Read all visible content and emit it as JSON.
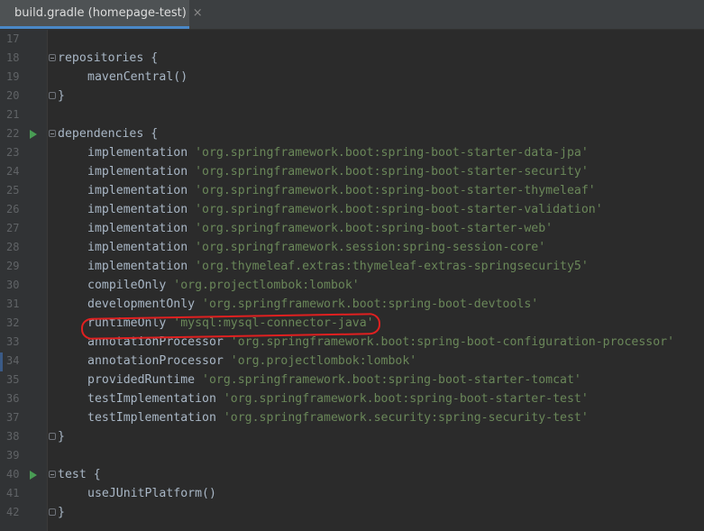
{
  "tab": {
    "title": "build.gradle (homepage-test)",
    "close_glyph": "×",
    "icon": "gradle-elephant-icon"
  },
  "colors": {
    "background": "#2b2b2b",
    "gutter": "#313335",
    "line_number": "#606366",
    "identifier": "#a9b7c6",
    "string": "#6a8759",
    "run_marker": "#499c54",
    "annotation_oval": "#e02020"
  },
  "lines": [
    {
      "n": "17",
      "indent": false,
      "text": "",
      "str": "",
      "fold": "none",
      "run": false
    },
    {
      "n": "18",
      "indent": false,
      "text": "repositories {",
      "str": "",
      "fold": "start",
      "run": false
    },
    {
      "n": "19",
      "indent": true,
      "text": "mavenCentral()",
      "str": "",
      "fold": "none",
      "run": false
    },
    {
      "n": "20",
      "indent": false,
      "text": "}",
      "str": "",
      "fold": "end",
      "run": false
    },
    {
      "n": "21",
      "indent": false,
      "text": "",
      "str": "",
      "fold": "none",
      "run": false
    },
    {
      "n": "22",
      "indent": false,
      "text": "dependencies {",
      "str": "",
      "fold": "start",
      "run": true
    },
    {
      "n": "23",
      "indent": true,
      "text": "implementation ",
      "str": "'org.springframework.boot:spring-boot-starter-data-jpa'",
      "fold": "none",
      "run": false
    },
    {
      "n": "24",
      "indent": true,
      "text": "implementation ",
      "str": "'org.springframework.boot:spring-boot-starter-security'",
      "fold": "none",
      "run": false
    },
    {
      "n": "25",
      "indent": true,
      "text": "implementation ",
      "str": "'org.springframework.boot:spring-boot-starter-thymeleaf'",
      "fold": "none",
      "run": false
    },
    {
      "n": "26",
      "indent": true,
      "text": "implementation ",
      "str": "'org.springframework.boot:spring-boot-starter-validation'",
      "fold": "none",
      "run": false
    },
    {
      "n": "27",
      "indent": true,
      "text": "implementation ",
      "str": "'org.springframework.boot:spring-boot-starter-web'",
      "fold": "none",
      "run": false
    },
    {
      "n": "28",
      "indent": true,
      "text": "implementation ",
      "str": "'org.springframework.session:spring-session-core'",
      "fold": "none",
      "run": false
    },
    {
      "n": "29",
      "indent": true,
      "text": "implementation ",
      "str": "'org.thymeleaf.extras:thymeleaf-extras-springsecurity5'",
      "fold": "none",
      "run": false
    },
    {
      "n": "30",
      "indent": true,
      "text": "compileOnly ",
      "str": "'org.projectlombok:lombok'",
      "fold": "none",
      "run": false
    },
    {
      "n": "31",
      "indent": true,
      "text": "developmentOnly ",
      "str": "'org.springframework.boot:spring-boot-devtools'",
      "fold": "none",
      "run": false
    },
    {
      "n": "32",
      "indent": true,
      "text": "runtimeOnly ",
      "str": "'mysql:mysql-connector-java'",
      "fold": "none",
      "run": false
    },
    {
      "n": "33",
      "indent": true,
      "text": "annotationProcessor ",
      "str": "'org.springframework.boot:spring-boot-configuration-processor'",
      "fold": "none",
      "run": false
    },
    {
      "n": "34",
      "indent": true,
      "text": "annotationProcessor ",
      "str": "'org.projectlombok:lombok'",
      "fold": "none",
      "run": false
    },
    {
      "n": "35",
      "indent": true,
      "text": "providedRuntime ",
      "str": "'org.springframework.boot:spring-boot-starter-tomcat'",
      "fold": "none",
      "run": false
    },
    {
      "n": "36",
      "indent": true,
      "text": "testImplementation ",
      "str": "'org.springframework.boot:spring-boot-starter-test'",
      "fold": "none",
      "run": false
    },
    {
      "n": "37",
      "indent": true,
      "text": "testImplementation ",
      "str": "'org.springframework.security:spring-security-test'",
      "fold": "none",
      "run": false
    },
    {
      "n": "38",
      "indent": false,
      "text": "}",
      "str": "",
      "fold": "end",
      "run": false
    },
    {
      "n": "39",
      "indent": false,
      "text": "",
      "str": "",
      "fold": "none",
      "run": false
    },
    {
      "n": "40",
      "indent": false,
      "text": "test {",
      "str": "",
      "fold": "start",
      "run": true
    },
    {
      "n": "41",
      "indent": true,
      "text": "useJUnitPlatform()",
      "str": "",
      "fold": "none",
      "run": false
    },
    {
      "n": "42",
      "indent": false,
      "text": "}",
      "str": "",
      "fold": "end",
      "run": false
    }
  ]
}
